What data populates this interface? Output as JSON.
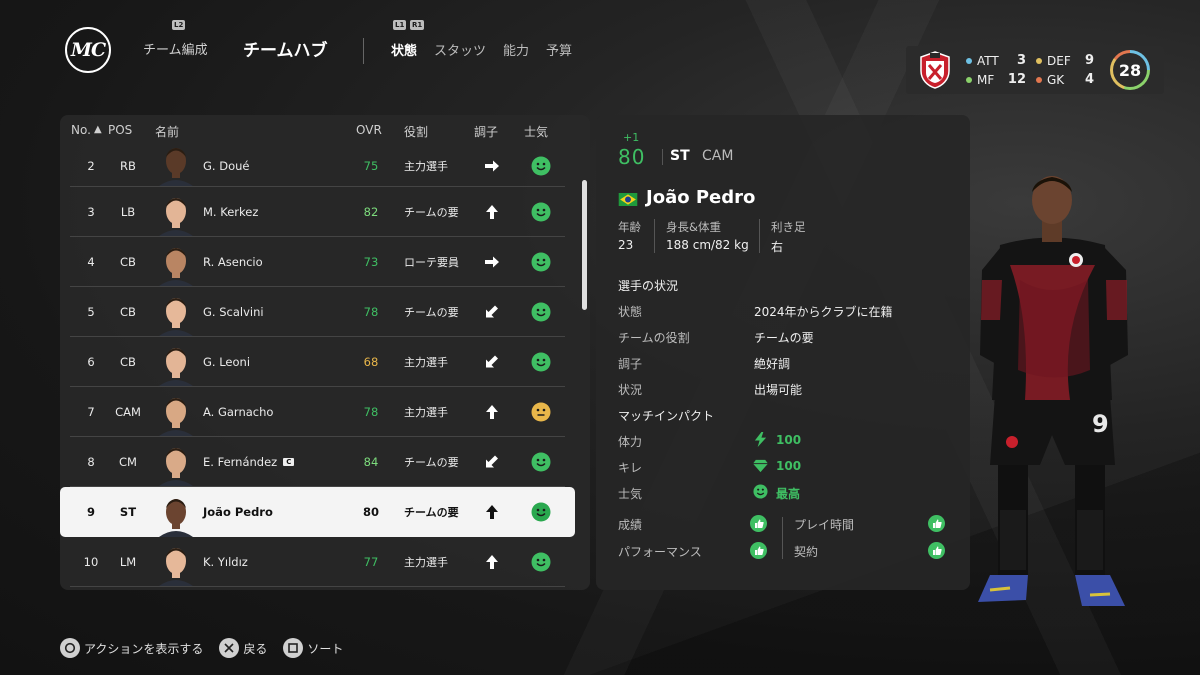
{
  "nav": {
    "logo": "MC",
    "l2_hint": "L2",
    "sub": "チーム編成",
    "main": "チームハブ",
    "l1_hint": "L1",
    "r1_hint": "R1",
    "tabs": [
      {
        "label": "状態",
        "active": true
      },
      {
        "label": "スタッツ",
        "active": false
      },
      {
        "label": "能力",
        "active": false
      },
      {
        "label": "予算",
        "active": false
      }
    ]
  },
  "club": {
    "positions": [
      {
        "label": "ATT",
        "value": "3",
        "color": "#6ec1e4"
      },
      {
        "label": "DEF",
        "value": "9",
        "color": "#e0c060"
      },
      {
        "label": "MF",
        "value": "12",
        "color": "#8bd26b"
      },
      {
        "label": "GK",
        "value": "4",
        "color": "#e2774f"
      }
    ],
    "total": "28"
  },
  "list": {
    "headers": {
      "no": "No.",
      "sort_icon": "▲",
      "pos": "POS",
      "name": "名前",
      "ovr": "OVR",
      "role": "役割",
      "form": "調子",
      "morale": "士気"
    },
    "rows": [
      {
        "no": "2",
        "pos": "RB",
        "name": "G. Doué",
        "ovr": "75",
        "ovr_color": "#3fbf63",
        "role": "主力選手",
        "form": "right",
        "morale": "happy",
        "captain": false,
        "selected": false,
        "skin": "#5a3a28"
      },
      {
        "no": "3",
        "pos": "LB",
        "name": "M. Kerkez",
        "ovr": "82",
        "ovr_color": "#7ddc7d",
        "role": "チームの要",
        "form": "up",
        "morale": "happy",
        "captain": false,
        "selected": false,
        "skin": "#e3b596"
      },
      {
        "no": "4",
        "pos": "CB",
        "name": "R. Asencio",
        "ovr": "73",
        "ovr_color": "#3fbf63",
        "role": "ローテ要員",
        "form": "right",
        "morale": "happy",
        "captain": false,
        "selected": false,
        "skin": "#b98563"
      },
      {
        "no": "5",
        "pos": "CB",
        "name": "G. Scalvini",
        "ovr": "78",
        "ovr_color": "#3fbf63",
        "role": "チームの要",
        "form": "down-left",
        "morale": "happy",
        "captain": false,
        "selected": false,
        "skin": "#e6b899"
      },
      {
        "no": "6",
        "pos": "CB",
        "name": "G. Leoni",
        "ovr": "68",
        "ovr_color": "#e8b64a",
        "role": "主力選手",
        "form": "down-left",
        "morale": "happy",
        "captain": false,
        "selected": false,
        "skin": "#e3b596"
      },
      {
        "no": "7",
        "pos": "CAM",
        "name": "A. Garnacho",
        "ovr": "78",
        "ovr_color": "#3fbf63",
        "role": "主力選手",
        "form": "up",
        "morale": "neutral",
        "captain": false,
        "selected": false,
        "skin": "#d8a884"
      },
      {
        "no": "8",
        "pos": "CM",
        "name": "E. Fernández",
        "ovr": "84",
        "ovr_color": "#7ddc7d",
        "role": "チームの要",
        "form": "down-left",
        "morale": "happy",
        "captain": true,
        "selected": false,
        "skin": "#d9aa88"
      },
      {
        "no": "9",
        "pos": "ST",
        "name": "João Pedro",
        "ovr": "80",
        "ovr_color": "#111111",
        "role": "チームの要",
        "form": "up",
        "morale": "happy",
        "captain": false,
        "selected": true,
        "skin": "#6b4430"
      },
      {
        "no": "10",
        "pos": "LM",
        "name": "K. Yıldız",
        "ovr": "77",
        "ovr_color": "#3fbf63",
        "role": "主力選手",
        "form": "up",
        "morale": "happy",
        "captain": false,
        "selected": false,
        "skin": "#e6b899"
      }
    ],
    "captain_label": "C"
  },
  "detail": {
    "ovr_change": "+1",
    "ovr": "80",
    "position": "ST",
    "alt_position": "CAM",
    "nationality": "Brazil",
    "name": "João Pedro",
    "bio": {
      "age_label": "年齢",
      "age": "23",
      "size_label": "身長&体重",
      "size": "188 cm/82 kg",
      "foot_label": "利き足",
      "foot": "右"
    },
    "status_title": "選手の状況",
    "status": [
      {
        "key": "状態",
        "value": "2024年からクラブに在籍"
      },
      {
        "key": "チームの役割",
        "value": "チームの要"
      },
      {
        "key": "調子",
        "value": "絶好調"
      },
      {
        "key": "状況",
        "value": "出場可能"
      }
    ],
    "impact_title": "マッチインパクト",
    "impact": [
      {
        "key": "体力",
        "value": "100",
        "icon": "lightning-icon"
      },
      {
        "key": "キレ",
        "value": "100",
        "icon": "diamond-icon"
      },
      {
        "key": "士気",
        "value": "最高",
        "icon": "smiley-icon"
      }
    ],
    "feedback": [
      {
        "label": "成績"
      },
      {
        "label": "プレイ時間"
      },
      {
        "label": "パフォーマンス"
      },
      {
        "label": "契約"
      }
    ]
  },
  "hints": [
    {
      "icon": "circle-button-icon",
      "label": "アクションを表示する"
    },
    {
      "icon": "cross-button-icon",
      "label": "戻る"
    },
    {
      "icon": "square-button-icon",
      "label": "ソート"
    }
  ],
  "colors": {
    "accent_green": "#3fbf63",
    "kit_red": "#8a1c26",
    "kit_black": "#141414"
  }
}
